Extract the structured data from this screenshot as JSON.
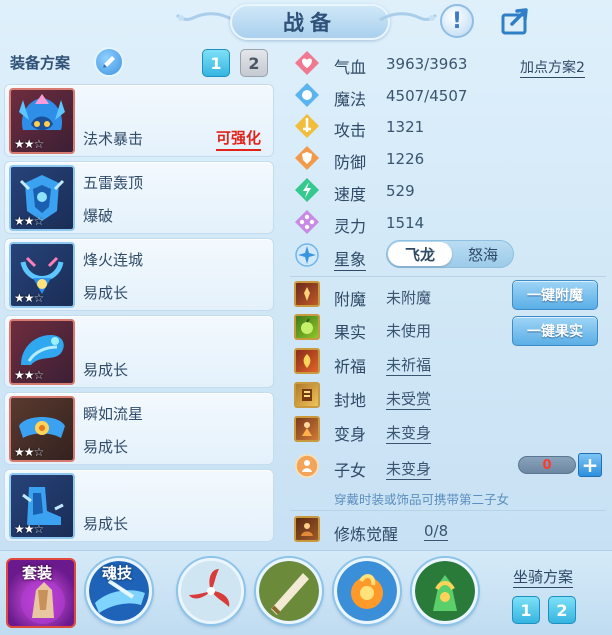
{
  "header": {
    "title": "战备"
  },
  "left": {
    "scheme_label": "装备方案",
    "tabs": [
      "1",
      "2"
    ],
    "items": [
      {
        "name": "",
        "effect": "法术暴击",
        "tag": "可强化",
        "stars_filled": 2,
        "stars_total": 3
      },
      {
        "name": "五雷轰顶",
        "effect": "爆破",
        "tag": "",
        "stars_filled": 2,
        "stars_total": 3
      },
      {
        "name": "烽火连城",
        "effect": "易成长",
        "tag": "",
        "stars_filled": 2,
        "stars_total": 3
      },
      {
        "name": "",
        "effect": "易成长",
        "tag": "",
        "stars_filled": 2,
        "stars_total": 3
      },
      {
        "name": "瞬如流星",
        "effect": "易成长",
        "tag": "",
        "stars_filled": 2,
        "stars_total": 3
      },
      {
        "name": "",
        "effect": "易成长",
        "tag": "",
        "stars_filled": 2,
        "stars_total": 3
      }
    ]
  },
  "stats": [
    {
      "label": "气血",
      "value": "3963/3963",
      "icon": "heart-icon",
      "color": "#e8607a"
    },
    {
      "label": "魔法",
      "value": "4507/4507",
      "icon": "magic-orb-icon",
      "color": "#4aa8ea"
    },
    {
      "label": "攻击",
      "value": "1321",
      "icon": "sword-icon",
      "color": "#f0b030"
    },
    {
      "label": "防御",
      "value": "1226",
      "icon": "shield-icon",
      "color": "#f08a3a"
    },
    {
      "label": "速度",
      "value": "529",
      "icon": "lightning-icon",
      "color": "#2cc78a"
    },
    {
      "label": "灵力",
      "value": "1514",
      "icon": "spirit-icon",
      "color": "#c07ae0"
    }
  ],
  "addpoint": "加点方案2",
  "star": {
    "label": "星象",
    "options": [
      "飞龙",
      "怒海"
    ],
    "selected": "飞龙"
  },
  "extras": [
    {
      "label": "附魔",
      "value": "未附魔",
      "underline": false
    },
    {
      "label": "果实",
      "value": "未使用",
      "underline": false
    },
    {
      "label": "祈福",
      "value": "未祈福",
      "underline": true
    },
    {
      "label": "封地",
      "value": "未受赏",
      "underline": true
    },
    {
      "label": "变身",
      "value": "未变身",
      "underline": true
    }
  ],
  "buttons": {
    "enchant": "一键附魔",
    "fruit": "一键果实"
  },
  "child": {
    "label": "子女",
    "value": "未变身",
    "count": "0",
    "plus": "+",
    "note": "穿戴时装或饰品可携带第二子女"
  },
  "cultivate": {
    "label": "修炼觉醒",
    "value": "0/8"
  },
  "bottom": {
    "suit_label": "套装",
    "soul_label": "魂技",
    "mount_label": "坐骑方案",
    "mount_tabs": [
      "1",
      "2"
    ]
  },
  "colors": {
    "accent": "#35b5e0",
    "warning": "#e0241b",
    "text": "#2f4a66"
  }
}
